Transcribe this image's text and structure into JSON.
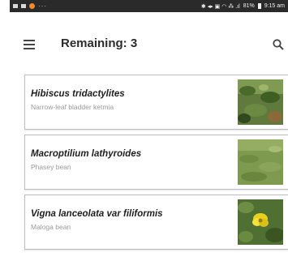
{
  "status_bar": {
    "left_ellipsis": "···",
    "signal": "81%",
    "time": "9:15 am"
  },
  "app_bar": {
    "title": "Remaining: 3",
    "menu_icon": "hamburger-menu-icon",
    "search_icon": "search-icon"
  },
  "species": [
    {
      "scientific_name": "Hibiscus tridactylites",
      "common_name": "Narrow-leaf bladder ketmia",
      "thumbnail": "plant-photo-hibiscus"
    },
    {
      "scientific_name": "Macroptilium lathyroides",
      "common_name": "Phasey bean",
      "thumbnail": "plant-photo-grass-field"
    },
    {
      "scientific_name": "Vigna lanceolata var filiformis",
      "common_name": "Maloga bean",
      "thumbnail": "plant-photo-yellow-flower"
    }
  ],
  "colors": {
    "status_bar_bg": "#2a2a2a",
    "notification_dot": "#f08a2c",
    "card_border": "#bdbdbd",
    "title_text": "#2c2c2c"
  }
}
